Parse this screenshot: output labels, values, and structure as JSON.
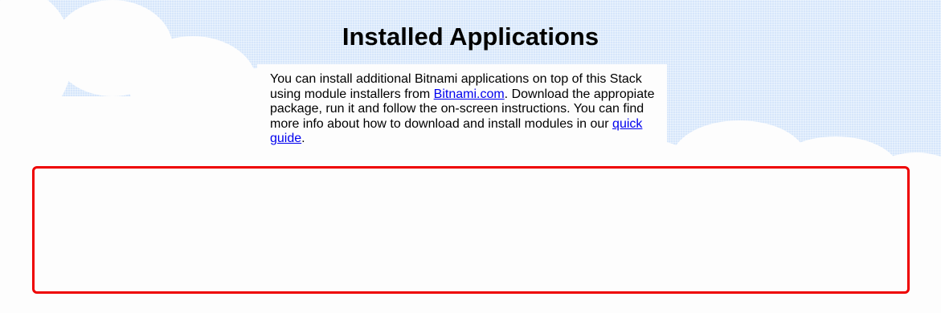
{
  "page": {
    "title": "Installed Applications"
  },
  "intro": {
    "text_1": "You can install additional Bitnami applications on top of this Stack using module installers from ",
    "link_bitnami": "Bitnami.com",
    "text_2": ". Download the appropiate package, run it and follow the on-screen instructions. You can find more info about how to download and install modules in our ",
    "link_quick_guide": "quick guide",
    "text_3": "."
  },
  "colors": {
    "sky": "#d6e6fb",
    "cloud": "#fdfdfd",
    "link": "#0000ee",
    "highlight_border": "#ee0000"
  }
}
